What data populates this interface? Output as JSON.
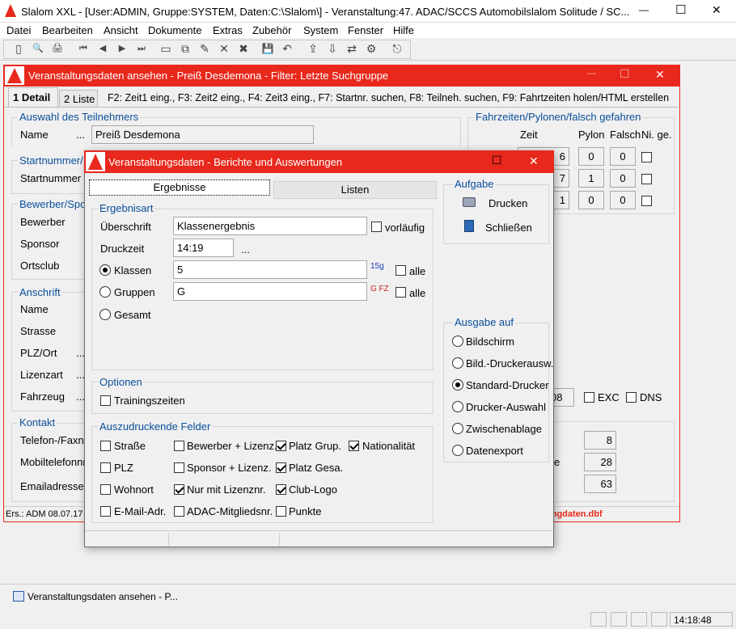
{
  "app": {
    "title": "Slalom XXL - [User:ADMIN, Gruppe:SYSTEM, Daten:C:\\Slalom\\] - Veranstaltung:47. ADAC/SCCS Automobilslalom Solitude / SC...",
    "min_glyph": "—",
    "max_glyph": "☐",
    "close_glyph": "✕"
  },
  "menu": [
    "Datei",
    "Bearbeiten",
    "Ansicht",
    "Dokumente",
    "Extras",
    "Zubehör",
    "System",
    "Fenster",
    "Hilfe"
  ],
  "toolbar": {
    "icons": [
      "page-icon",
      "page-search-icon",
      "page-print-icon",
      "first-icon",
      "prev-icon",
      "next-icon",
      "last-icon",
      "new-icon",
      "copy-icon",
      "edit-icon",
      "delete-icon",
      "delete-all-icon",
      "save-icon",
      "undo-icon",
      "export-icon",
      "import-icon",
      "sync-icon",
      "settings-icon",
      "exit-icon"
    ],
    "glyphs": [
      "▯",
      "🔍",
      "🖨",
      "⏮",
      "◀",
      "▶",
      "⏭",
      "▭",
      "⧉",
      "✎",
      "✕",
      "✖",
      "💾",
      "↶",
      "⇪",
      "⇩",
      "⇄",
      "⚙",
      "⎋"
    ]
  },
  "window1": {
    "title": "Veranstaltungsdaten ansehen - Preiß Desdemona - Filter: Letzte Suchgruppe",
    "tabs": [
      {
        "label": "1 Detail",
        "active": true
      },
      {
        "label": "2 Liste",
        "active": false
      }
    ],
    "shortcuts": "F2: Zeit1 eing., F3: Zeit2 eing., F4: Zeit3 eing., F7: Startnr. suchen, F8: Teilneh. suchen, F9: Fahrtzeiten holen/HTML erstellen",
    "group_teilnehmer": "Auswahl des Teilnehmers",
    "name_label": "Name",
    "name_dots": "...",
    "name_value": "Preiß Desdemona",
    "group_startnummer": "Startnummer/",
    "startnummer_label": "Startnummer",
    "group_bewerber": "Bewerber/Spo",
    "bewerber_label": "Bewerber",
    "sponsor_label": "Sponsor",
    "ortsclub_label": "Ortsclub",
    "group_anschrift": "Anschrift",
    "anschrift_name": "Name",
    "strasse": "Strasse",
    "plz_ort": "PLZ/Ort",
    "lizenzart": "Lizenzart",
    "fahrzeug": "Fahrzeug",
    "group_kontakt": "Kontakt",
    "telefon": "Telefon-/Faxnr",
    "mobil": "Mobiltelefonnr",
    "email": "Emailadresse",
    "dots": "...",
    "group_fahrzeiten": "Fahrzeiten/Pylonen/falsch gefahren",
    "col_zeit": "Zeit",
    "col_pylon": "Pylon",
    "col_falsch": "Falsch",
    "col_nige": "Ni. ge.",
    "rows": [
      {
        "zeit": "6",
        "pylon": "0",
        "falsch": "0"
      },
      {
        "zeit": "7",
        "pylon": "1",
        "falsch": "0"
      },
      {
        "zeit": "1",
        "pylon": "0",
        "falsch": "0"
      }
    ],
    "field_08": "08",
    "exc": "EXC",
    "dns": "DNS",
    "stat_8": "8",
    "stat_e": "e",
    "stat_28": "28",
    "stat_63": "63",
    "status_left": "Ers.: ADM 08.07.17",
    "status_right": "ungdaten.dbf"
  },
  "dialog": {
    "title": "Veranstaltungsdaten - Berichte und Auswertungen",
    "tabs": [
      {
        "label": "Ergebnisse",
        "active": true
      },
      {
        "label": "Listen",
        "active": false
      }
    ],
    "group_ergebnisart": "Ergebnisart",
    "ueberschrift_label": "Überschrift",
    "ueberschrift_value": "Klassenergebnis",
    "vorlaeufig": "vorläufig",
    "druckzeit_label": "Druckzeit",
    "druckzeit_value": "14:19",
    "druckzeit_dots": "...",
    "klassen_label": "Klassen",
    "klassen_value": "5",
    "klassen_icon_text": "15g",
    "gruppen_label": "Gruppen",
    "gruppen_value": "G",
    "gruppen_icon_text": "G FZ",
    "alle": "alle",
    "gesamt_label": "Gesamt",
    "group_optionen": "Optionen",
    "trainingszeiten": "Trainingszeiten",
    "group_felder": "Auszudruckende Felder",
    "felder": [
      {
        "label": "Straße",
        "checked": false
      },
      {
        "label": "Bewerber + Lizenz.",
        "checked": false
      },
      {
        "label": "Platz Grup.",
        "checked": true
      },
      {
        "label": "Nationalität",
        "checked": true
      },
      {
        "label": "PLZ",
        "checked": false
      },
      {
        "label": "Sponsor + Lizenz.",
        "checked": false
      },
      {
        "label": "Platz Gesa.",
        "checked": true
      },
      {
        "label": "Wohnort",
        "checked": false
      },
      {
        "label": "Nur mit Lizenznr.",
        "checked": true
      },
      {
        "label": "Club-Logo",
        "checked": true
      },
      {
        "label": "E-Mail-Adr.",
        "checked": false
      },
      {
        "label": "ADAC-Mitgliedsnr.",
        "checked": false
      },
      {
        "label": "Punkte",
        "checked": false
      }
    ],
    "group_aufgabe": "Aufgabe",
    "drucken": "Drucken",
    "schliessen": "Schließen",
    "group_ausgabe": "Ausgabe auf",
    "ausgabe": [
      {
        "label": "Bildschirm",
        "selected": false
      },
      {
        "label": "Bild.-Druckerausw.",
        "selected": false
      },
      {
        "label": "Standard-Drucker",
        "selected": true
      },
      {
        "label": "Drucker-Auswahl",
        "selected": false
      },
      {
        "label": "Zwischenablage",
        "selected": false
      },
      {
        "label": "Datenexport",
        "selected": false
      }
    ]
  },
  "taskbar": {
    "item": "Veranstaltungsdaten ansehen - P...",
    "time": "14:18:48"
  },
  "colors": {
    "accent_red": "#e8281c",
    "label_blue": "#0a4e9a",
    "status_red": "#e8281c"
  }
}
